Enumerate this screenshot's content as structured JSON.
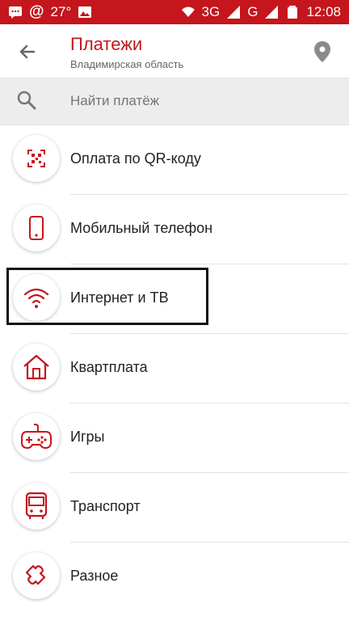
{
  "statusbar": {
    "temperature": "27°",
    "network": "3G",
    "network2": "G",
    "time": "12:08"
  },
  "header": {
    "title": "Платежи",
    "subtitle": "Владимирская область"
  },
  "search": {
    "placeholder": "Найти платёж"
  },
  "items": [
    {
      "label": "Оплата по QR-коду",
      "icon": "qr-icon"
    },
    {
      "label": "Мобильный телефон",
      "icon": "phone-icon"
    },
    {
      "label": "Интернет и ТВ",
      "icon": "wifi-icon"
    },
    {
      "label": "Квартплата",
      "icon": "house-icon"
    },
    {
      "label": "Игры",
      "icon": "gamepad-icon"
    },
    {
      "label": "Транспорт",
      "icon": "bus-icon"
    },
    {
      "label": "Разное",
      "icon": "puzzle-icon"
    }
  ],
  "colors": {
    "accent": "#c4161c"
  }
}
